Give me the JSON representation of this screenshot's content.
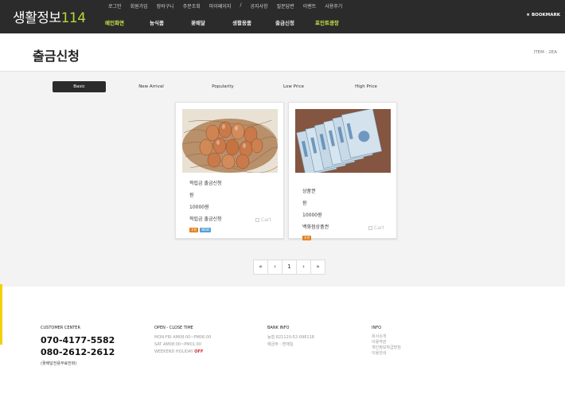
{
  "header": {
    "logo_text": "생활정보",
    "logo_num": "114",
    "util_menu": [
      "로그인",
      "회원가입",
      "장바구니",
      "주문조회",
      "마이페이지",
      "/",
      "공지사항",
      "질문답변",
      "이벤트",
      "사용후기"
    ],
    "main_nav": [
      "메인화면",
      "농식품",
      "꽃배달",
      "생활용품",
      "출금신청",
      "포인트광장"
    ],
    "bookmark": "★ BOOKMARK"
  },
  "page": {
    "title": "출금신청",
    "item_count": "ITEM : 2EA"
  },
  "sort_tabs": [
    "Basic",
    "New Arrival",
    "Popularity",
    "Low Price",
    "High Price"
  ],
  "products": [
    {
      "name": "적립금 출금신청",
      "unit": "원",
      "price": "10000원",
      "desc": "적립금 출금신청",
      "cart": "Cart",
      "badges": [
        "추천",
        "NEW"
      ]
    },
    {
      "name": "상품권",
      "unit": "원",
      "price": "10000원",
      "desc": "백화점상품권",
      "cart": "Cart",
      "badges": [
        "추천"
      ]
    }
  ],
  "pagination": [
    "«",
    "‹",
    "1",
    "›",
    "»"
  ],
  "footer": {
    "customer_center": {
      "title": "CUSTOMER CENTER",
      "phone1": "070-4177-5582",
      "phone2": "080-2612-2612",
      "note": "(꽃배달전용무료전화)"
    },
    "hours": {
      "title": "OPEN - CLOSE TIME",
      "line1": "MON-FRI AM08:00~PM06:00",
      "line2": "SAT AM08:00~PM01:00",
      "line3": "WEEKEND HOLIDAY",
      "off": "OFF"
    },
    "bank": {
      "title": "BANK INFO",
      "line1": "농협 821120-52-098118",
      "line2": "예금주 : 변재일"
    },
    "info": {
      "title": "INFO",
      "links": [
        "회사소개",
        "이용약관",
        "개인정보취급방침",
        "이용안내"
      ]
    }
  },
  "colors": {
    "header_bg": "#2b2b2b",
    "accent_green": "#b6d83a",
    "nav_highlight": "#c8e64b",
    "badge_orange": "#e0801c",
    "badge_blue": "#5aa0d6",
    "side_tab": "#f2d10b"
  }
}
